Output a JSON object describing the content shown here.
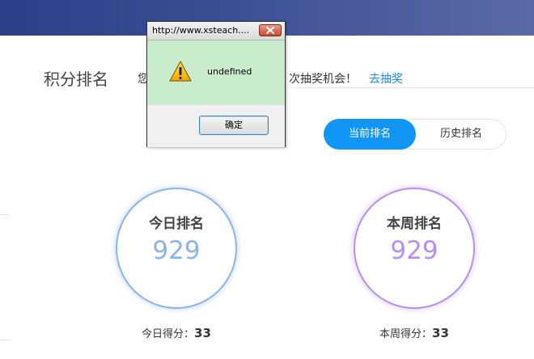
{
  "header": {
    "title": "积分排名"
  },
  "notice": {
    "prefix": "您",
    "suffix": "次抽奖机会！",
    "link_label": "去抽奖"
  },
  "tabs": [
    {
      "label": "当前排名",
      "active": true
    },
    {
      "label": "历史排名",
      "active": false
    }
  ],
  "ranks": {
    "today": {
      "label": "今日排名",
      "value": "929",
      "score_label": "今日得分：",
      "score_value": "33"
    },
    "week": {
      "label": "本周排名",
      "value": "929",
      "score_label": "本周得分：",
      "score_value": "33"
    }
  },
  "dialog": {
    "title": "http://www.xsteach....",
    "message": "undefined",
    "ok_label": "确定",
    "icon": "warning-icon"
  },
  "colors": {
    "accent": "#1296f5",
    "today": "#8ab4ea",
    "week": "#b690f0",
    "dialog_bg": "#c9edcc",
    "link": "#1e88e5"
  }
}
